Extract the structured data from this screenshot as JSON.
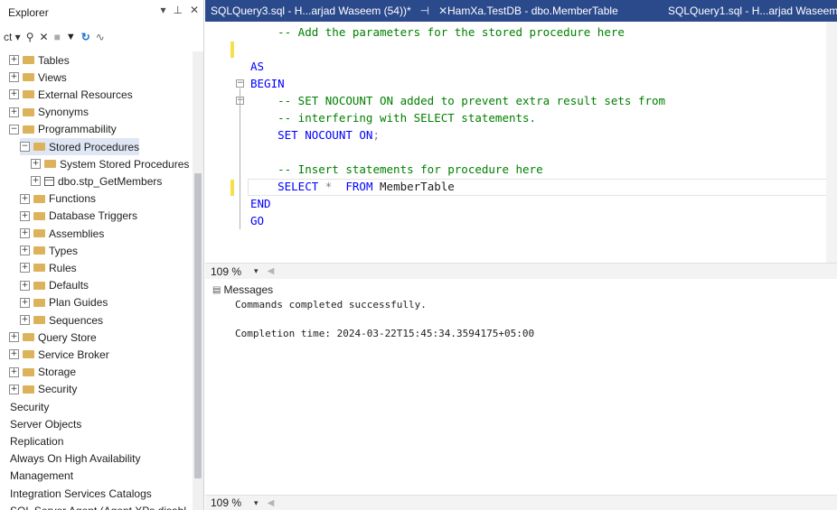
{
  "explorer": {
    "title": "Explorer",
    "title_icons": [
      "▾",
      "⊥",
      "✕"
    ],
    "toolbar": {
      "connect": "ct ▾",
      "filter_icon": "filter-icon",
      "refresh_icon": "refresh-icon",
      "activity_icon": "activity-icon"
    },
    "tree": [
      {
        "label": "Tables",
        "exp": "⊞",
        "icon": "folder"
      },
      {
        "label": "Views",
        "exp": "⊞",
        "icon": "folder"
      },
      {
        "label": "External Resources",
        "exp": "⊞",
        "icon": "folder"
      },
      {
        "label": "Synonyms",
        "exp": "⊞",
        "icon": "folder"
      },
      {
        "label": "Programmability",
        "exp": "⊟",
        "icon": "folder"
      },
      {
        "label": "Stored Procedures",
        "exp": "⊟",
        "icon": "folder"
      },
      {
        "label": "System Stored Procedures",
        "exp": "⊞",
        "icon": "folder"
      },
      {
        "label": "dbo.stp_GetMembers",
        "exp": "⊞",
        "icon": "table"
      },
      {
        "label": "Functions",
        "exp": "⊞",
        "icon": "folder"
      },
      {
        "label": "Database Triggers",
        "exp": "⊞",
        "icon": "folder"
      },
      {
        "label": "Assemblies",
        "exp": "⊞",
        "icon": "folder"
      },
      {
        "label": "Types",
        "exp": "⊞",
        "icon": "folder"
      },
      {
        "label": "Rules",
        "exp": "⊞",
        "icon": "folder"
      },
      {
        "label": "Defaults",
        "exp": "⊞",
        "icon": "folder"
      },
      {
        "label": "Plan Guides",
        "exp": "⊞",
        "icon": "folder"
      },
      {
        "label": "Sequences",
        "exp": "⊞",
        "icon": "folder"
      },
      {
        "label": "Query Store",
        "exp": "⊞",
        "icon": "folder"
      },
      {
        "label": "Service Broker",
        "exp": "⊞",
        "icon": "folder"
      },
      {
        "label": "Storage",
        "exp": "⊞",
        "icon": "folder"
      },
      {
        "label": "Security",
        "exp": "⊞",
        "icon": "folder"
      },
      {
        "label": "Security",
        "exp": "",
        "icon": ""
      },
      {
        "label": "Server Objects",
        "exp": "",
        "icon": ""
      },
      {
        "label": "Replication",
        "exp": "",
        "icon": ""
      },
      {
        "label": "Always On High Availability",
        "exp": "",
        "icon": ""
      },
      {
        "label": "Management",
        "exp": "",
        "icon": ""
      },
      {
        "label": "Integration Services Catalogs",
        "exp": "",
        "icon": ""
      },
      {
        "label": "SQL Server Agent (Agent XPs disabl",
        "exp": "",
        "icon": ""
      }
    ]
  },
  "tabs": [
    {
      "label": "SQLQuery3.sql - H...arjad Waseem (54))*",
      "pin": "⊣",
      "close": "✕"
    },
    {
      "label": "HamXa.TestDB - dbo.MemberTable"
    },
    {
      "label": "SQLQuery1.sql - H...arjad Waseem"
    }
  ],
  "editor": {
    "lines": [
      {
        "segments": [
          {
            "t": "    -- Add the parameters for the stored procedure here",
            "c": "cm"
          }
        ]
      },
      {
        "segments": [
          {
            "t": "",
            "c": "pl"
          }
        ]
      },
      {
        "segments": [
          {
            "t": "AS",
            "c": "kw"
          }
        ]
      },
      {
        "segments": [
          {
            "t": "BEGIN",
            "c": "kw"
          }
        ]
      },
      {
        "segments": [
          {
            "t": "    -- SET NOCOUNT ON added to prevent extra result sets from",
            "c": "cm"
          }
        ]
      },
      {
        "segments": [
          {
            "t": "    -- interfering with SELECT statements.",
            "c": "cm"
          }
        ]
      },
      {
        "segments": [
          {
            "t": "    SET NOCOUNT ON",
            "c": "kw"
          },
          {
            "t": ";",
            "c": "gy"
          }
        ]
      },
      {
        "segments": [
          {
            "t": "",
            "c": "pl"
          }
        ]
      },
      {
        "segments": [
          {
            "t": "    -- Insert statements for procedure here",
            "c": "cm"
          }
        ]
      },
      {
        "segments": [
          {
            "t": "    SELECT ",
            "c": "kw"
          },
          {
            "t": "* ",
            "c": "gy"
          },
          {
            "t": " FROM ",
            "c": "kw"
          },
          {
            "t": "MemberTable",
            "c": "pl"
          }
        ]
      },
      {
        "segments": [
          {
            "t": "END",
            "c": "kw"
          }
        ]
      },
      {
        "segments": [
          {
            "t": "GO",
            "c": "kw"
          }
        ]
      }
    ]
  },
  "zoom": {
    "value": "109 %",
    "dropdown": "▾",
    "scroll_left": "◀"
  },
  "messages": {
    "tab_label": "Messages",
    "lines": [
      "Commands completed successfully.",
      "",
      "Completion time: 2024-03-22T15:45:34.3594175+05:00"
    ]
  }
}
